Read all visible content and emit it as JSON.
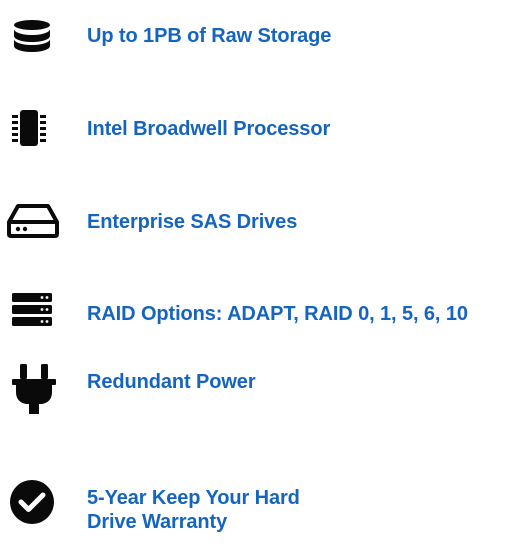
{
  "colors": {
    "icon": "#0a0a0a",
    "label": "#1565c0"
  },
  "features": [
    {
      "icon": "database-icon",
      "label": "Up to 1PB of Raw Storage"
    },
    {
      "icon": "microchip-icon",
      "label": "Intel Broadwell Processor"
    },
    {
      "icon": "hard-drive-icon",
      "label": "Enterprise SAS Drives"
    },
    {
      "icon": "server-icon",
      "label": "RAID Options: ADAPT, RAID 0, 1, 5, 6, 10"
    },
    {
      "icon": "power-plug-icon",
      "label": "Redundant Power"
    },
    {
      "icon": "check-circle-icon",
      "label_lines": [
        "5-Year Keep Your Hard",
        "Drive Warranty"
      ]
    }
  ]
}
